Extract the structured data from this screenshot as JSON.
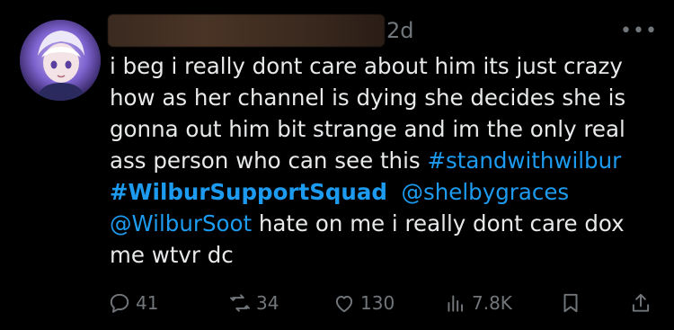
{
  "post": {
    "author": {
      "name_redacted": "",
      "avatar_icon": "anime-character-avatar"
    },
    "time": "2d",
    "more_label": "•••",
    "lines": [
      "i beg i really dont care about him its just crazy",
      "how as her channel is dying she decides she is",
      "gonna out him bit strange and im the only real",
      "ass person who can see this "
    ],
    "hashtag_1": "#standwithwilbur",
    "hashtag_2": "#WilburSupportSquad",
    "mention_1": "@shelbygraces",
    "mention_2": "@WilburSoot",
    "line_6_rest": " hate on me i really dont care dox",
    "line_7": "me wtvr dc"
  },
  "actions": {
    "replies": "41",
    "reposts": "34",
    "likes": "130",
    "views": "7.8K"
  },
  "colors": {
    "background": "#000000",
    "text": "#e7e9ea",
    "muted": "#71767b",
    "link": "#1d9bf0"
  }
}
